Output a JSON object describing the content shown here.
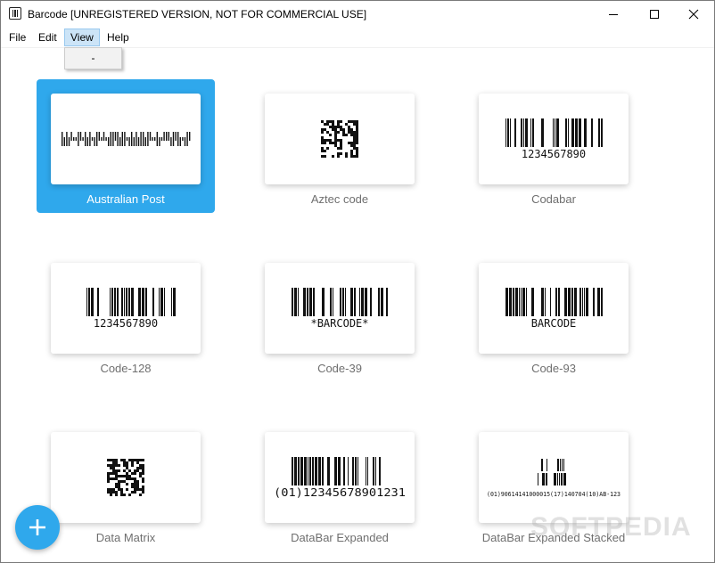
{
  "window": {
    "title": "Barcode [UNREGISTERED VERSION, NOT FOR COMMERCIAL USE]",
    "app_icon": "barcode-icon",
    "controls": [
      "minimize-icon",
      "maximize-icon",
      "close-icon"
    ]
  },
  "menubar": {
    "items": [
      {
        "label": "File"
      },
      {
        "label": "Edit"
      },
      {
        "label": "View",
        "active": true
      },
      {
        "label": "Help"
      }
    ]
  },
  "dropdown": {
    "items": [
      {
        "label": "-"
      }
    ]
  },
  "barcodes": [
    {
      "label": "Australian Post",
      "selected": true,
      "preview": "4-state linear barcode"
    },
    {
      "label": "Aztec code",
      "selected": false,
      "preview": "2D Aztec symbol"
    },
    {
      "label": "Codabar",
      "selected": false,
      "preview_text": "1234567890"
    },
    {
      "label": "Code-128",
      "selected": false,
      "preview_text": "1234567890"
    },
    {
      "label": "Code-39",
      "selected": false,
      "preview_text": "*BARCODE*"
    },
    {
      "label": "Code-93",
      "selected": false,
      "preview_text": "BARCODE"
    },
    {
      "label": "Data Matrix",
      "selected": false,
      "preview": "2D Data Matrix symbol"
    },
    {
      "label": "DataBar Expanded",
      "selected": false,
      "preview_text": "(01)12345678901231"
    },
    {
      "label": "DataBar Expanded Stacked",
      "selected": false,
      "preview_text": "(01)90614141000015(17)140704(10)AB-123"
    }
  ],
  "add_button": {
    "icon": "plus-icon"
  },
  "watermark": "SOFTPEDIA",
  "colors": {
    "accent": "#2fa8ec",
    "label_text": "#6f6f6f",
    "selected_label_text": "#ffffff"
  }
}
